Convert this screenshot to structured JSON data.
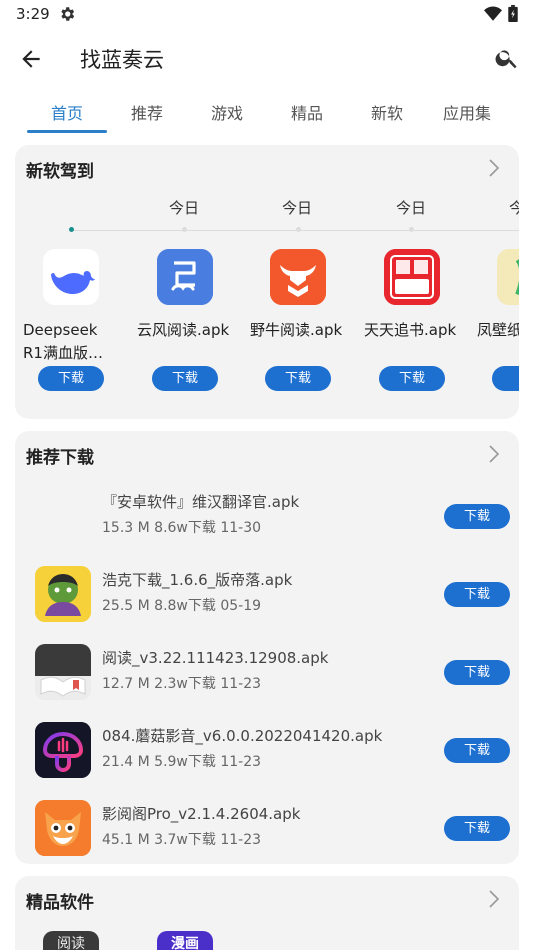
{
  "status_bar": {
    "time": "3:29"
  },
  "app_bar": {
    "title": "找蓝奏云"
  },
  "tabs": [
    {
      "label": "首页"
    },
    {
      "label": "推荐"
    },
    {
      "label": "游戏"
    },
    {
      "label": "精品"
    },
    {
      "label": "新软"
    },
    {
      "label": "应用集"
    }
  ],
  "colors": {
    "accent": "#2a7fc8",
    "button": "#1d6fd0",
    "card_bg": "#f3f3f3",
    "timeline_dot": "#1a8f8f"
  },
  "new_section": {
    "title": "新软驾到",
    "dates": [
      "今日",
      "今日",
      "今日",
      "今日",
      "今"
    ],
    "apps": [
      {
        "name": "Deepseek R1满血版…",
        "icon": "deepseek-whale-icon",
        "button": "下载"
      },
      {
        "name": "云风阅读.apk",
        "icon": "yunfeng-reader-icon",
        "button": "下载"
      },
      {
        "name": "野牛阅读.apk",
        "icon": "bison-reader-icon",
        "button": "下载"
      },
      {
        "name": "天天追书.apk",
        "icon": "tiantian-zhuishu-icon",
        "button": "下载"
      },
      {
        "name": "凤壁纸",
        "icon": "wallpaper-icon",
        "button": "下"
      }
    ]
  },
  "recommend_section": {
    "title": "推荐下载",
    "items": [
      {
        "name": "『安卓软件』维汉翻译官.apk",
        "size": "15.3 M",
        "downloads": "8.6w下载",
        "date": "11-30",
        "button": "下载",
        "icon": ""
      },
      {
        "name": "浩克下载_1.6.6_版帝落.apk",
        "size": "25.5 M",
        "downloads": "8.8w下载",
        "date": "05-19",
        "button": "下载",
        "icon": "hulk-icon"
      },
      {
        "name": "阅读_v3.22.111423.12908.apk",
        "size": "12.7 M",
        "downloads": "2.3w下载",
        "date": "11-23",
        "button": "下载",
        "icon": "yuedu-reader-icon"
      },
      {
        "name": "084.蘑菇影音_v6.0.0.2022041420.apk",
        "size": "21.4 M",
        "downloads": "5.9w下载",
        "date": "11-23",
        "button": "下载",
        "icon": "mushroom-player-icon"
      },
      {
        "name": "影阅阁Pro_v2.1.4.2604.apk",
        "size": "45.1 M",
        "downloads": "3.7w下载",
        "date": "11-23",
        "button": "下载",
        "icon": "fox-icon"
      }
    ]
  },
  "premium_section": {
    "title": "精品软件",
    "icon_texts": [
      "阅读",
      "漫画"
    ]
  }
}
